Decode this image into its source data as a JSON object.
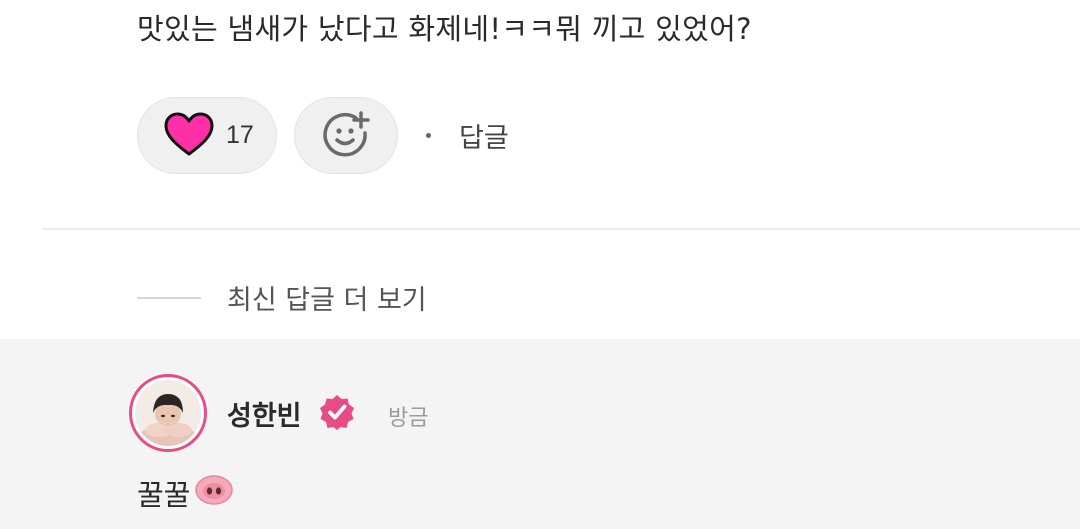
{
  "comment": {
    "text": "맛있는 냄새가 났다고 화제네!ㅋㅋ뭐 끼고 있었어?"
  },
  "actions": {
    "like_icon": "heart-icon",
    "like_count": "17",
    "reaction_icon": "add-emoji-icon",
    "reply_label": "답글"
  },
  "more_replies": {
    "label": "최신 답글 더 보기"
  },
  "reply": {
    "author": "성한빈",
    "verified_icon": "verified-badge-icon",
    "time": "방금",
    "text": "꿀꿀",
    "emoji": "pig-nose-icon"
  },
  "colors": {
    "heart": "#ff2fa8",
    "accent": "#e94b87",
    "reply_bg": "#f4f4f4"
  }
}
